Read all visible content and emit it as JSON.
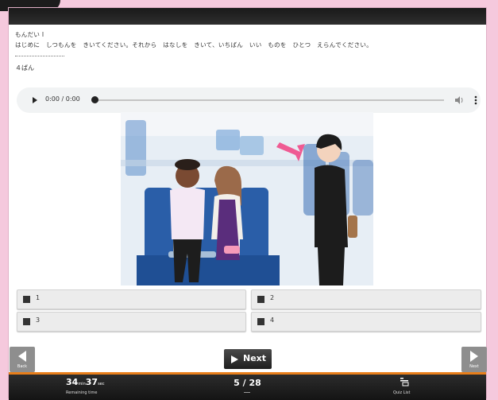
{
  "header": {
    "title": "もんだい I"
  },
  "instruction": "はじめに　しつもんを　きいてください。それから　はなしを　きいて、いちばん　いい　ものを　ひとつ　えらんでください。",
  "question_number": "４ばん",
  "audio": {
    "time": "0:00 / 0:00",
    "progress": 0
  },
  "choices": [
    {
      "label": "1"
    },
    {
      "label": "2"
    },
    {
      "label": "3"
    },
    {
      "label": "4"
    }
  ],
  "nav": {
    "back_label": "Back",
    "next_label": "Next",
    "next_small_label": "Next"
  },
  "footer": {
    "minutes": "34",
    "min_unit": "min",
    "seconds": "37",
    "sec_unit": "sec",
    "remaining_label": "Remaining time",
    "counter": "5 / 28",
    "quiz_list_label": "Quiz List"
  },
  "colors": {
    "accent": "#e87e1a",
    "frame_bg": "#f5c9dd",
    "arrow": "#ef5b93"
  },
  "icons": [
    "play-icon",
    "volume-icon",
    "more-options-icon",
    "back-arrow-icon",
    "next-arrow-icon",
    "quiz-list-icon"
  ]
}
